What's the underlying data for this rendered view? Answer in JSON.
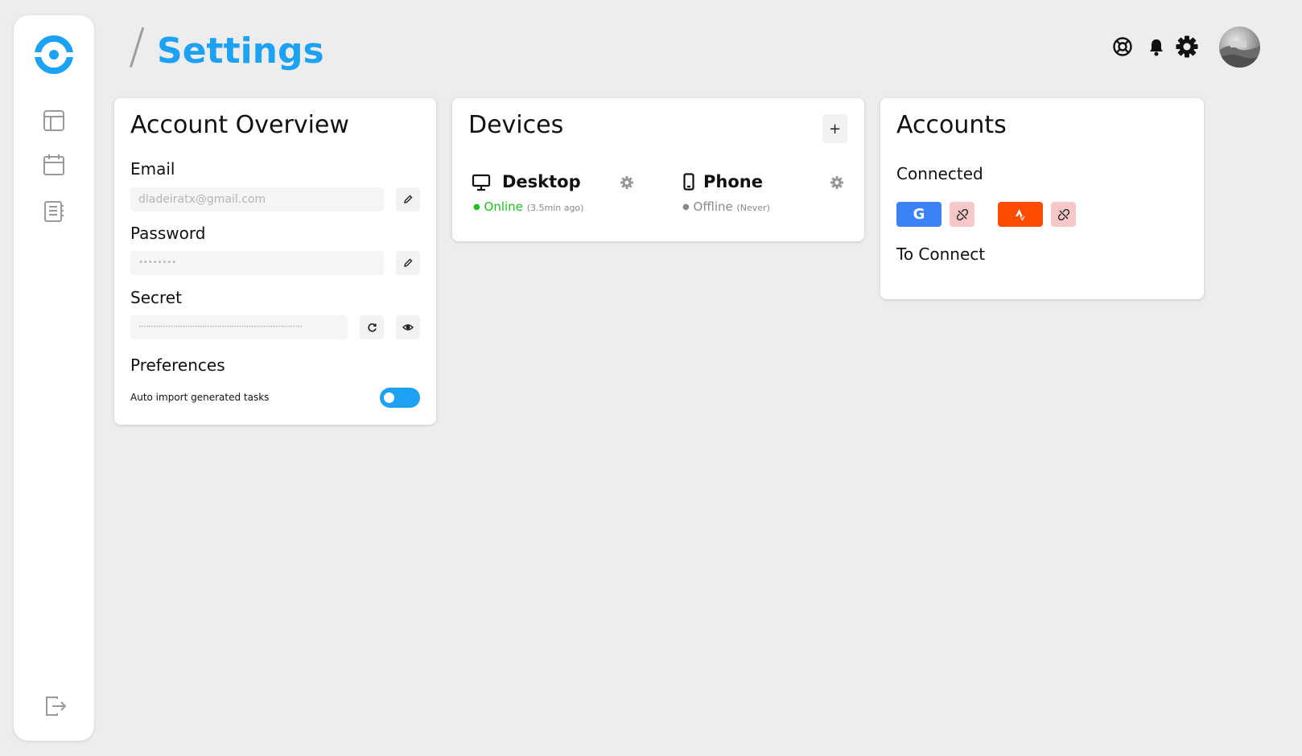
{
  "page": {
    "title": "Settings",
    "slash": "/"
  },
  "sidebar": {
    "items": [
      {
        "name": "dashboard",
        "icon": "layout-icon"
      },
      {
        "name": "calendar",
        "icon": "calendar-icon"
      },
      {
        "name": "notes",
        "icon": "notes-icon"
      }
    ],
    "logout_icon": "logout-icon"
  },
  "header": {
    "icons": [
      "help-icon",
      "bell-icon",
      "gear-icon"
    ],
    "avatar": "avatar"
  },
  "account_overview": {
    "title": "Account Overview",
    "email_label": "Email",
    "email_value": "dladeiratx@gmail.com",
    "password_label": "Password",
    "password_value": "••••••••",
    "secret_label": "Secret",
    "secret_value": "•••••••••••••••••••••••••••••••••••••••••••••••••••••••••••••••••••",
    "preferences_label": "Preferences",
    "pref_auto_import_label": "Auto import generated tasks",
    "pref_auto_import_on": true
  },
  "devices": {
    "title": "Devices",
    "add_label": "+",
    "list": [
      {
        "name": "Desktop",
        "status": "Online",
        "status_detail": "(3.5min ago)",
        "status_color": "#1fbf1f"
      },
      {
        "name": "Phone",
        "status": "Offline",
        "status_detail": "(Never)",
        "status_color": "#8a8a8a"
      }
    ]
  },
  "accounts": {
    "title": "Accounts",
    "connected_label": "Connected",
    "to_connect_label": "To Connect",
    "connected": [
      {
        "service": "Google",
        "glyph": "G",
        "color": "#3b82f6"
      },
      {
        "service": "Strava",
        "glyph": "strava-icon",
        "color": "#fc4c02"
      }
    ]
  },
  "colors": {
    "accent": "#1da1f2",
    "online": "#1fbf1f",
    "unlink_bg": "#f8c8c8"
  }
}
